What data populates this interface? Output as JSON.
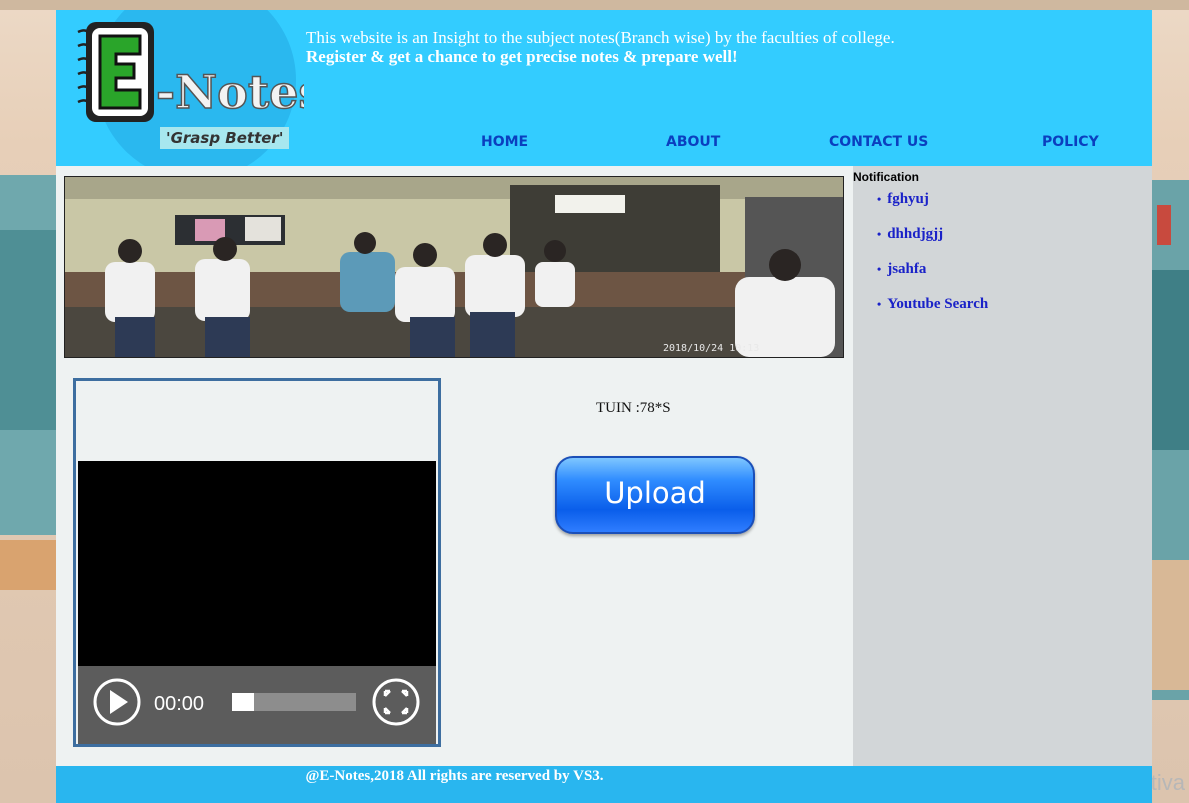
{
  "header": {
    "logo_text": "E-Notes",
    "tagline": "'Grasp Better'",
    "intro_line1": "This website is an Insight to the subject notes(Branch wise) by the faculties of college.",
    "intro_line2": "Register & get a chance to get precise notes & prepare well!"
  },
  "nav": [
    "HOME",
    "ABOUT",
    "CONTACT US",
    "POLICY"
  ],
  "photo": {
    "timestamp": "2018/10/24 10:13"
  },
  "sidebar": {
    "title": "Notification",
    "items": [
      "fghyuj",
      "dhhdjgjj",
      "jsahfa",
      "Youtube Search"
    ]
  },
  "video": {
    "time": "00:00",
    "progress": 0.18
  },
  "main": {
    "tuin": "TUIN :78*S",
    "upload_label": "Upload"
  },
  "footer": {
    "text": "@E-Notes,2018 All rights are reserved by VS3."
  },
  "os": {
    "watermark": "Activa"
  },
  "colors": {
    "header_bg": "#33ccff",
    "nav_text": "#0b3fbf",
    "link": "#1a22c8",
    "footer_bg": "#29b6ef"
  }
}
